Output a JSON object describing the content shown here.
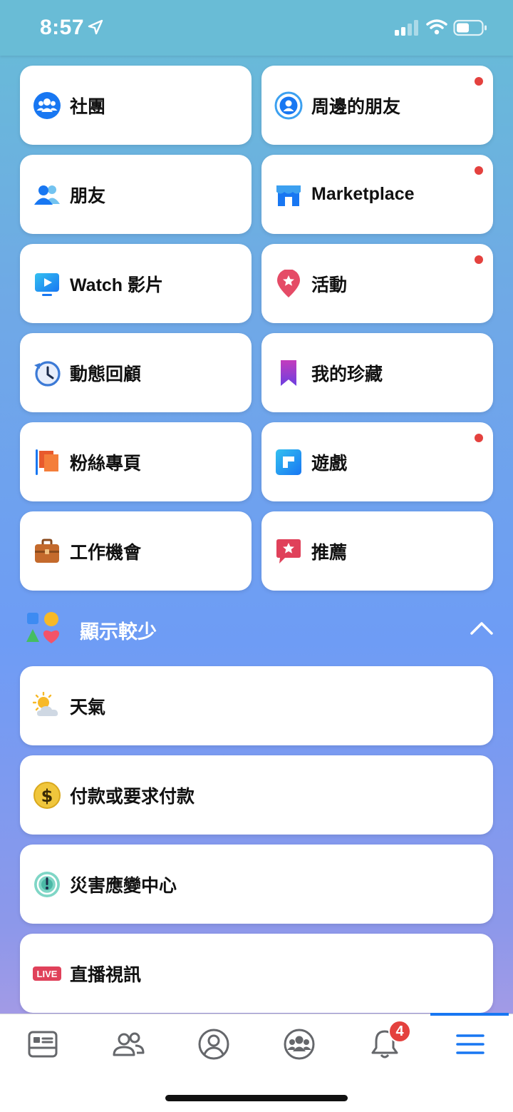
{
  "status_bar": {
    "time": "8:57"
  },
  "shortcuts": [
    {
      "label": "社團",
      "icon": "groups-icon",
      "dot": false
    },
    {
      "label": "周邊的朋友",
      "icon": "nearby-friends-icon",
      "dot": true
    },
    {
      "label": "朋友",
      "icon": "friends-icon",
      "dot": false
    },
    {
      "label": "Marketplace",
      "icon": "marketplace-icon",
      "dot": true
    },
    {
      "label": "Watch 影片",
      "icon": "watch-icon",
      "dot": false
    },
    {
      "label": "活動",
      "icon": "events-icon",
      "dot": true
    },
    {
      "label": "動態回顧",
      "icon": "memories-icon",
      "dot": false
    },
    {
      "label": "我的珍藏",
      "icon": "saved-icon",
      "dot": false
    },
    {
      "label": "粉絲專頁",
      "icon": "pages-icon",
      "dot": false
    },
    {
      "label": "遊戲",
      "icon": "gaming-icon",
      "dot": true
    },
    {
      "label": "工作機會",
      "icon": "jobs-icon",
      "dot": false
    },
    {
      "label": "推薦",
      "icon": "recommendations-icon",
      "dot": false
    }
  ],
  "section": {
    "label": "顯示較少",
    "icon": "shapes-icon",
    "toggle_icon": "chevron-up-icon"
  },
  "more_items": [
    {
      "label": "天氣",
      "icon": "weather-icon"
    },
    {
      "label": "付款或要求付款",
      "icon": "payments-icon"
    },
    {
      "label": "災害應變中心",
      "icon": "crisis-response-icon"
    },
    {
      "label": "直播視訊",
      "icon": "live-video-icon",
      "badge_text": "LIVE"
    }
  ],
  "tab_bar": {
    "tabs": [
      "news-feed-icon",
      "friends-tab-icon",
      "profile-icon",
      "groups-tab-icon",
      "notifications-icon",
      "menu-icon"
    ],
    "notification_count": "4",
    "active": "menu-icon"
  },
  "colors": {
    "accent": "#1877f2",
    "dot": "#e4413e"
  }
}
